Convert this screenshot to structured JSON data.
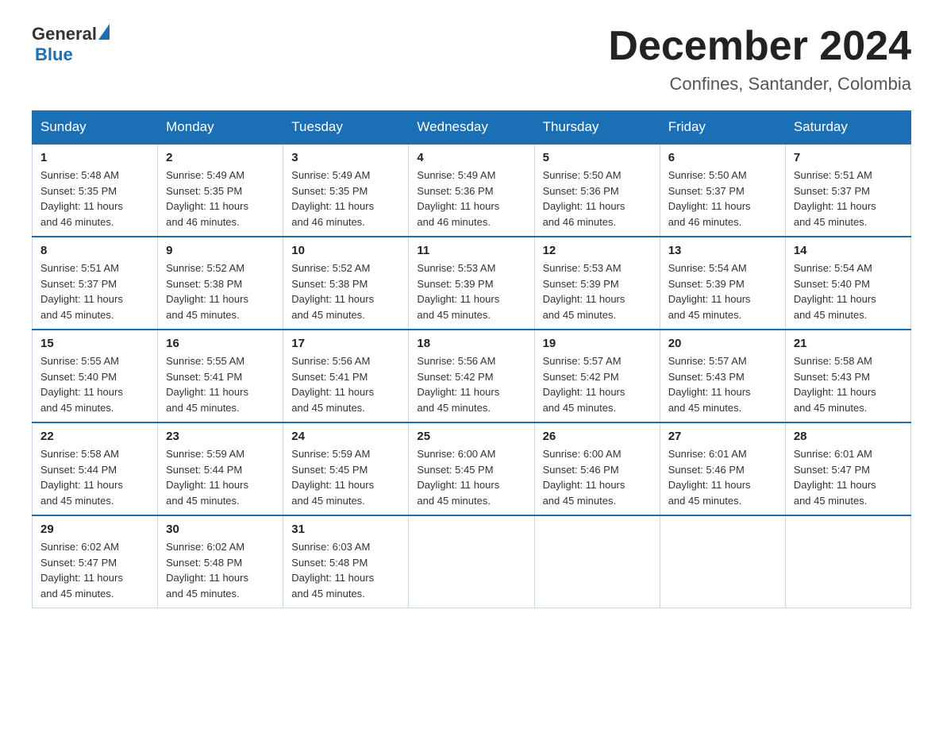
{
  "header": {
    "logo_general": "General",
    "logo_blue": "Blue",
    "month_title": "December 2024",
    "location": "Confines, Santander, Colombia"
  },
  "columns": [
    "Sunday",
    "Monday",
    "Tuesday",
    "Wednesday",
    "Thursday",
    "Friday",
    "Saturday"
  ],
  "weeks": [
    [
      {
        "day": "1",
        "sunrise": "5:48 AM",
        "sunset": "5:35 PM",
        "daylight": "11 hours and 46 minutes."
      },
      {
        "day": "2",
        "sunrise": "5:49 AM",
        "sunset": "5:35 PM",
        "daylight": "11 hours and 46 minutes."
      },
      {
        "day": "3",
        "sunrise": "5:49 AM",
        "sunset": "5:35 PM",
        "daylight": "11 hours and 46 minutes."
      },
      {
        "day": "4",
        "sunrise": "5:49 AM",
        "sunset": "5:36 PM",
        "daylight": "11 hours and 46 minutes."
      },
      {
        "day": "5",
        "sunrise": "5:50 AM",
        "sunset": "5:36 PM",
        "daylight": "11 hours and 46 minutes."
      },
      {
        "day": "6",
        "sunrise": "5:50 AM",
        "sunset": "5:37 PM",
        "daylight": "11 hours and 46 minutes."
      },
      {
        "day": "7",
        "sunrise": "5:51 AM",
        "sunset": "5:37 PM",
        "daylight": "11 hours and 45 minutes."
      }
    ],
    [
      {
        "day": "8",
        "sunrise": "5:51 AM",
        "sunset": "5:37 PM",
        "daylight": "11 hours and 45 minutes."
      },
      {
        "day": "9",
        "sunrise": "5:52 AM",
        "sunset": "5:38 PM",
        "daylight": "11 hours and 45 minutes."
      },
      {
        "day": "10",
        "sunrise": "5:52 AM",
        "sunset": "5:38 PM",
        "daylight": "11 hours and 45 minutes."
      },
      {
        "day": "11",
        "sunrise": "5:53 AM",
        "sunset": "5:39 PM",
        "daylight": "11 hours and 45 minutes."
      },
      {
        "day": "12",
        "sunrise": "5:53 AM",
        "sunset": "5:39 PM",
        "daylight": "11 hours and 45 minutes."
      },
      {
        "day": "13",
        "sunrise": "5:54 AM",
        "sunset": "5:39 PM",
        "daylight": "11 hours and 45 minutes."
      },
      {
        "day": "14",
        "sunrise": "5:54 AM",
        "sunset": "5:40 PM",
        "daylight": "11 hours and 45 minutes."
      }
    ],
    [
      {
        "day": "15",
        "sunrise": "5:55 AM",
        "sunset": "5:40 PM",
        "daylight": "11 hours and 45 minutes."
      },
      {
        "day": "16",
        "sunrise": "5:55 AM",
        "sunset": "5:41 PM",
        "daylight": "11 hours and 45 minutes."
      },
      {
        "day": "17",
        "sunrise": "5:56 AM",
        "sunset": "5:41 PM",
        "daylight": "11 hours and 45 minutes."
      },
      {
        "day": "18",
        "sunrise": "5:56 AM",
        "sunset": "5:42 PM",
        "daylight": "11 hours and 45 minutes."
      },
      {
        "day": "19",
        "sunrise": "5:57 AM",
        "sunset": "5:42 PM",
        "daylight": "11 hours and 45 minutes."
      },
      {
        "day": "20",
        "sunrise": "5:57 AM",
        "sunset": "5:43 PM",
        "daylight": "11 hours and 45 minutes."
      },
      {
        "day": "21",
        "sunrise": "5:58 AM",
        "sunset": "5:43 PM",
        "daylight": "11 hours and 45 minutes."
      }
    ],
    [
      {
        "day": "22",
        "sunrise": "5:58 AM",
        "sunset": "5:44 PM",
        "daylight": "11 hours and 45 minutes."
      },
      {
        "day": "23",
        "sunrise": "5:59 AM",
        "sunset": "5:44 PM",
        "daylight": "11 hours and 45 minutes."
      },
      {
        "day": "24",
        "sunrise": "5:59 AM",
        "sunset": "5:45 PM",
        "daylight": "11 hours and 45 minutes."
      },
      {
        "day": "25",
        "sunrise": "6:00 AM",
        "sunset": "5:45 PM",
        "daylight": "11 hours and 45 minutes."
      },
      {
        "day": "26",
        "sunrise": "6:00 AM",
        "sunset": "5:46 PM",
        "daylight": "11 hours and 45 minutes."
      },
      {
        "day": "27",
        "sunrise": "6:01 AM",
        "sunset": "5:46 PM",
        "daylight": "11 hours and 45 minutes."
      },
      {
        "day": "28",
        "sunrise": "6:01 AM",
        "sunset": "5:47 PM",
        "daylight": "11 hours and 45 minutes."
      }
    ],
    [
      {
        "day": "29",
        "sunrise": "6:02 AM",
        "sunset": "5:47 PM",
        "daylight": "11 hours and 45 minutes."
      },
      {
        "day": "30",
        "sunrise": "6:02 AM",
        "sunset": "5:48 PM",
        "daylight": "11 hours and 45 minutes."
      },
      {
        "day": "31",
        "sunrise": "6:03 AM",
        "sunset": "5:48 PM",
        "daylight": "11 hours and 45 minutes."
      },
      null,
      null,
      null,
      null
    ]
  ],
  "labels": {
    "sunrise": "Sunrise: ",
    "sunset": "Sunset: ",
    "daylight": "Daylight: "
  }
}
